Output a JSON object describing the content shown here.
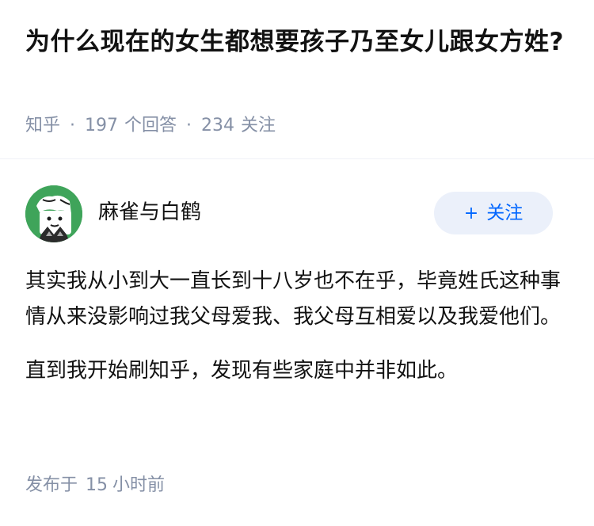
{
  "question": {
    "title": "为什么现在的女生都想要孩子乃至女儿跟女方姓?",
    "source": "知乎",
    "answer_count": "197",
    "answer_label": "个回答",
    "follower_count": "234",
    "follower_label": "关注",
    "separator": "·"
  },
  "answer": {
    "author": {
      "name": "麻雀与白鹤",
      "avatar_icon": "cartoon-character-avatar-icon"
    },
    "follow_button": {
      "icon": "+",
      "label": "关注"
    },
    "paragraphs": [
      "其实我从小到大一直长到十八岁也不在乎，毕竟姓氏这种事情从来没影响过我父母爱我、我父母互相爱以及我爱他们。",
      "直到我开始刷知乎，发现有些家庭中并非如此。"
    ],
    "time": {
      "prefix": "发布于",
      "value": "15",
      "unit": "小时前"
    }
  },
  "colors": {
    "text": "#121212",
    "meta": "#8590a6",
    "accent": "#0066ff",
    "follow_bg": "#ebf0fa",
    "avatar_bg": "#3fa45a"
  }
}
